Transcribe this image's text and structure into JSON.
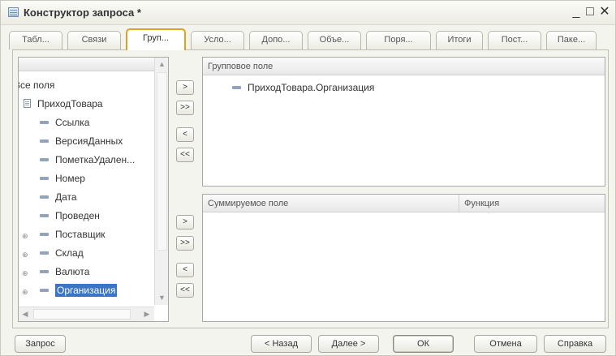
{
  "window": {
    "title": "Конструктор запроса *",
    "minimize_icon": "minimize-icon",
    "maximize_icon": "maximize-icon",
    "close_icon": "close-icon"
  },
  "tabs": [
    {
      "label": "Табл...",
      "active": false
    },
    {
      "label": "Связи",
      "active": false
    },
    {
      "label": "Груп...",
      "active": true
    },
    {
      "label": "Усло...",
      "active": false
    },
    {
      "label": "Допо...",
      "active": false
    },
    {
      "label": "Объе...",
      "active": false
    },
    {
      "label": "Поря...",
      "active": false
    },
    {
      "label": "Итоги",
      "active": false
    },
    {
      "label": "Пост...",
      "active": false
    },
    {
      "label": "Паке...",
      "active": false
    }
  ],
  "fields_tree": {
    "root_label": "Все поля",
    "table_label": "ПриходТовара",
    "fields": [
      {
        "label": "Ссылка",
        "expandable": false,
        "selected": false
      },
      {
        "label": "ВерсияДанных",
        "expandable": false,
        "selected": false
      },
      {
        "label": "ПометкаУдален...",
        "expandable": false,
        "selected": false
      },
      {
        "label": "Номер",
        "expandable": false,
        "selected": false
      },
      {
        "label": "Дата",
        "expandable": false,
        "selected": false
      },
      {
        "label": "Проведен",
        "expandable": false,
        "selected": false
      },
      {
        "label": "Поставщик",
        "expandable": true,
        "selected": false
      },
      {
        "label": "Склад",
        "expandable": true,
        "selected": false
      },
      {
        "label": "Валюта",
        "expandable": true,
        "selected": false
      },
      {
        "label": "Организация",
        "expandable": true,
        "selected": true
      }
    ]
  },
  "move_buttons": {
    "add": ">",
    "add_all": ">>",
    "remove": "<",
    "remove_all": "<<"
  },
  "group_fields": {
    "header": "Групповое поле",
    "items": [
      "ПриходТовара.Организация"
    ]
  },
  "summary_fields": {
    "header_field": "Суммируемое поле",
    "header_function": "Функция",
    "items": []
  },
  "bottom_buttons": {
    "query": "Запрос",
    "back": "< Назад",
    "next": "Далее >",
    "ok": "ОК",
    "cancel": "Отмена",
    "help": "Справка"
  },
  "colors": {
    "active_tab_border": "#e2a21f",
    "selection": "#3b74c4"
  }
}
